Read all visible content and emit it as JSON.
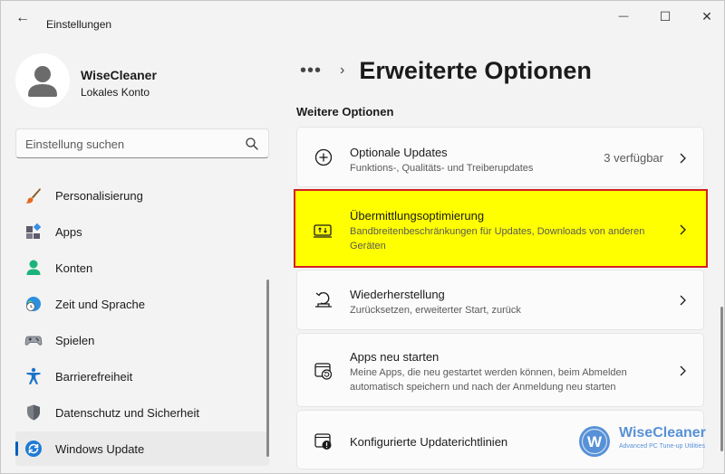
{
  "window": {
    "title": "Einstellungen",
    "back_glyph": "←",
    "minimize_glyph": "—",
    "maximize_glyph": "☐",
    "close_glyph": "✕"
  },
  "profile": {
    "name": "WiseCleaner",
    "account_type": "Lokales Konto"
  },
  "search": {
    "placeholder": "Einstellung suchen"
  },
  "sidebar": {
    "items": [
      {
        "label": "Personalisierung",
        "icon": "paintbrush-icon",
        "active": false
      },
      {
        "label": "Apps",
        "icon": "apps-icon",
        "active": false
      },
      {
        "label": "Konten",
        "icon": "person-icon",
        "active": false
      },
      {
        "label": "Zeit und Sprache",
        "icon": "globe-clock-icon",
        "active": false
      },
      {
        "label": "Spielen",
        "icon": "gamepad-icon",
        "active": false
      },
      {
        "label": "Barrierefreiheit",
        "icon": "accessibility-icon",
        "active": false
      },
      {
        "label": "Datenschutz und Sicherheit",
        "icon": "shield-icon",
        "active": false
      },
      {
        "label": "Windows Update",
        "icon": "sync-icon",
        "active": true
      }
    ]
  },
  "breadcrumb": {
    "more": "•••",
    "separator": "›",
    "page_title": "Erweiterte Optionen"
  },
  "section": {
    "title": "Weitere Optionen"
  },
  "cards": [
    {
      "title": "Optionale Updates",
      "desc": "Funktions-, Qualitäts- und Treiberupdates",
      "value": "3 verfügbar",
      "icon": "plus-circle-icon"
    },
    {
      "title": "Übermittlungsoptimierung",
      "desc": "Bandbreitenbeschränkungen für Updates, Downloads von anderen Geräten",
      "value": "",
      "icon": "delivery-optimization-icon",
      "highlighted": true
    },
    {
      "title": "Wiederherstellung",
      "desc": "Zurücksetzen, erweiterter Start, zurück",
      "value": "",
      "icon": "recovery-icon"
    },
    {
      "title": "Apps neu starten",
      "desc": "Meine Apps, die neu gestartet werden können, beim Abmelden automatisch speichern und nach der Anmeldung neu starten",
      "value": "",
      "icon": "restart-apps-icon"
    },
    {
      "title": "Konfigurierte Updaterichtlinien",
      "desc": "",
      "value": "",
      "icon": "policy-icon"
    }
  ],
  "watermark": {
    "brand": "WiseCleaner",
    "tagline": "Advanced PC Tune-up Utilities",
    "logo_letter": "W"
  },
  "colors": {
    "accent": "#005fb8",
    "highlight": "#ffff00",
    "highlight_border": "#d42020"
  }
}
